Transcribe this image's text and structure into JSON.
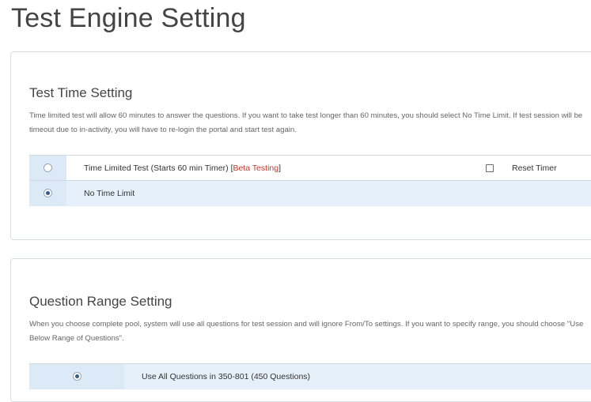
{
  "page": {
    "title": "Test Engine Setting"
  },
  "time_setting": {
    "heading": "Test Time Setting",
    "description": "Time limited test will allow 60 minutes to answer the questions. If you want to take test longer than 60 minutes, you should select No Time Limit. If test session will be timeout due to in-activity, you will have to re-login the portal and start test again.",
    "options": [
      {
        "label": "Time Limited Test (Starts 60 min Timer)",
        "tag_open": "[",
        "tag": "Beta Testing",
        "tag_close": "]",
        "checked": false
      },
      {
        "label": "No Time Limit",
        "checked": true
      }
    ],
    "reset_timer_label": "Reset Timer",
    "reset_timer_checked": false
  },
  "range_setting": {
    "heading": "Question Range Setting",
    "description": "When you choose complete pool, system will use all questions for test session and will ignore From/To settings. If you want to specify range, you should choose \"Use Below Range of Questions\".",
    "options": [
      {
        "label": "Use All Questions in 350-801 (450 Questions)",
        "checked": true
      }
    ]
  }
}
